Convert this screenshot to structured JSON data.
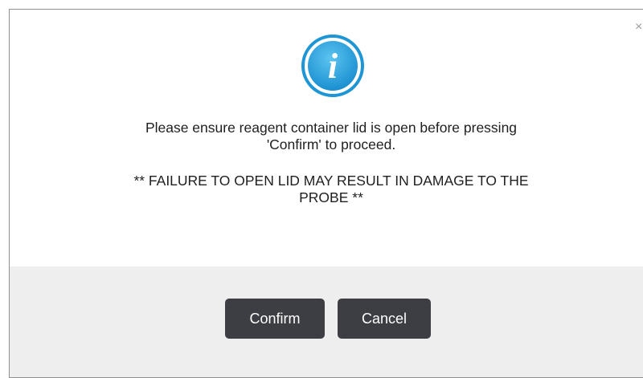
{
  "dialog": {
    "close_glyph": "×",
    "icon": "info-circle-icon",
    "icon_letter": "i",
    "accent_color": "#2a9fd8",
    "message": {
      "line1": "Please ensure reagent container lid is open before pressing",
      "line2": "'Confirm' to proceed.",
      "warning_line1": "** FAILURE TO OPEN LID MAY RESULT IN DAMAGE TO THE",
      "warning_line2": "PROBE **"
    },
    "buttons": {
      "confirm_label": "Confirm",
      "cancel_label": "Cancel"
    }
  }
}
